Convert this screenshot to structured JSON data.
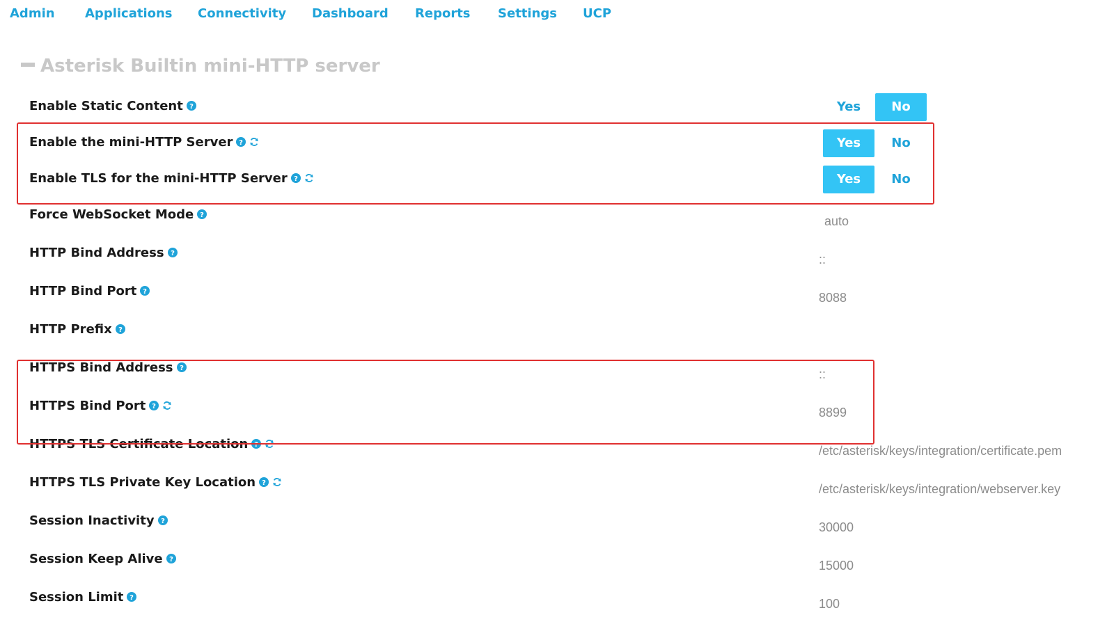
{
  "nav": {
    "items": [
      "Admin",
      "Applications",
      "Connectivity",
      "Dashboard",
      "Reports",
      "Settings",
      "UCP"
    ]
  },
  "section": {
    "title": "Asterisk Builtin mini-HTTP server"
  },
  "colors": {
    "accent": "#1fa3d9",
    "toggle_active": "#33c4f5",
    "highlight": "#e03030"
  },
  "icons": {
    "help": "help-circle-icon",
    "reload": "reload-icon",
    "collapse": "minus-icon"
  },
  "settings": [
    {
      "label": "Enable Static Content",
      "toggle": {
        "yes": "Yes",
        "no": "No",
        "selected": "No"
      }
    },
    {
      "label": "Enable the mini-HTTP Server",
      "toggle": {
        "yes": "Yes",
        "no": "No",
        "selected": "Yes"
      },
      "reload": true
    },
    {
      "label": "Enable TLS for the mini-HTTP Server",
      "toggle": {
        "yes": "Yes",
        "no": "No",
        "selected": "Yes"
      },
      "reload": true
    },
    {
      "label": "Force WebSocket Mode",
      "value": "auto"
    },
    {
      "label": "HTTP Bind Address",
      "value": "::"
    },
    {
      "label": "HTTP Bind Port",
      "value": "8088"
    },
    {
      "label": "HTTP Prefix",
      "value": ""
    },
    {
      "label": "HTTPS Bind Address",
      "value": "::"
    },
    {
      "label": "HTTPS Bind Port",
      "value": "8899",
      "reload": true
    },
    {
      "label": "HTTPS TLS Certificate Location",
      "value": "/etc/asterisk/keys/integration/certificate.pem",
      "reload": true
    },
    {
      "label": "HTTPS TLS Private Key Location",
      "value": "/etc/asterisk/keys/integration/webserver.key",
      "reload": true
    },
    {
      "label": "Session Inactivity",
      "value": "30000"
    },
    {
      "label": "Session Keep Alive",
      "value": "15000"
    },
    {
      "label": "Session Limit",
      "value": "100"
    }
  ]
}
